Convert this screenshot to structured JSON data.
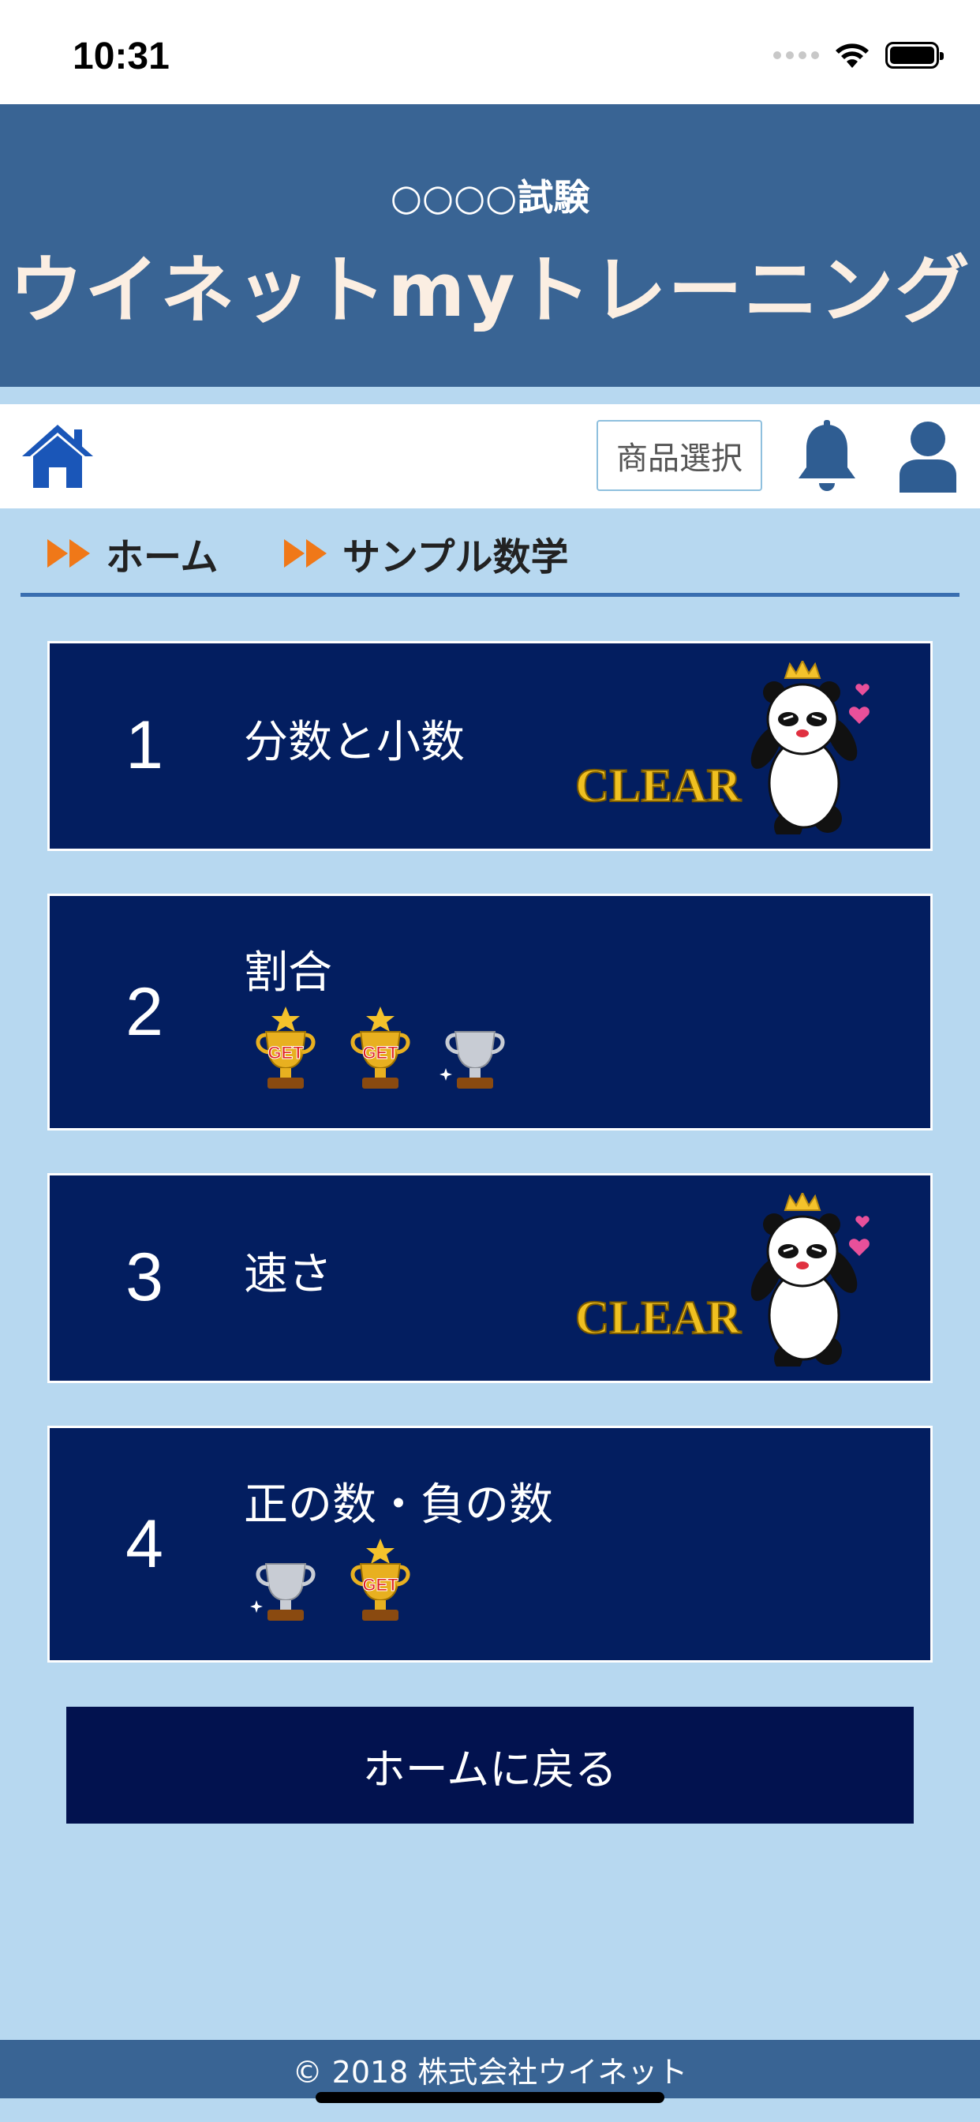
{
  "status_bar": {
    "time": "10:31"
  },
  "header": {
    "exam_name": "○○○○試験",
    "app_title": "ウイネットmyトレーニング"
  },
  "navbar": {
    "product_button": "商品選択"
  },
  "breadcrumb": [
    {
      "label": "ホーム"
    },
    {
      "label": "サンプル数学"
    }
  ],
  "lessons": [
    {
      "number": "1",
      "title": "分数と小数",
      "badge": "CLEAR",
      "trophies": []
    },
    {
      "number": "2",
      "title": "割合",
      "trophies": [
        {
          "type": "gold",
          "label": "GET"
        },
        {
          "type": "gold",
          "label": "GET"
        },
        {
          "type": "silver"
        }
      ]
    },
    {
      "number": "3",
      "title": "速さ",
      "badge": "CLEAR",
      "trophies": []
    },
    {
      "number": "4",
      "title": "正の数・負の数",
      "trophies": [
        {
          "type": "silver"
        },
        {
          "type": "gold",
          "label": "GET"
        }
      ]
    }
  ],
  "back_button": "ホームに戻る",
  "footer": {
    "copyright": "© 2018 株式会社ウイネット"
  },
  "colors": {
    "header": "#396494",
    "background": "#b7d8f0",
    "card": "#031e60",
    "back_button": "#02124f",
    "accent_arrow": "#f07818",
    "icon_blue": "#1a56b8"
  }
}
